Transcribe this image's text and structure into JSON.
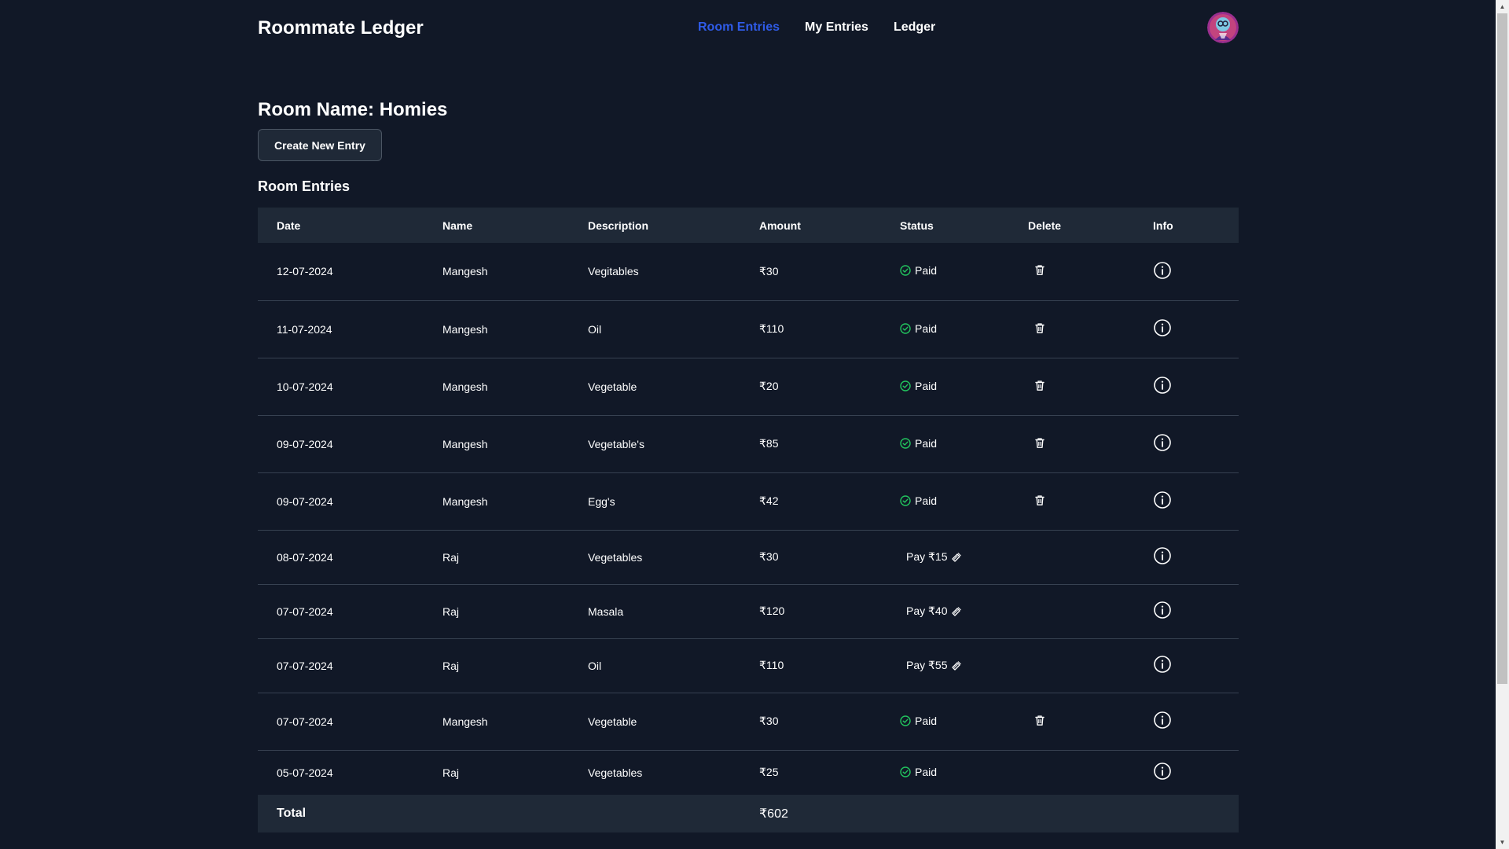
{
  "app": {
    "brand": "Roommate Ledger"
  },
  "nav": {
    "items": [
      {
        "label": "Room Entries",
        "active": true
      },
      {
        "label": "My Entries",
        "active": false
      },
      {
        "label": "Ledger",
        "active": false
      }
    ]
  },
  "room": {
    "title": "Room Name: Homies",
    "create_button": "Create New Entry",
    "section_title": "Room Entries"
  },
  "table": {
    "headers": {
      "date": "Date",
      "name": "Name",
      "description": "Description",
      "amount": "Amount",
      "status": "Status",
      "delete": "Delete",
      "info": "Info"
    },
    "rows": [
      {
        "date": "12-07-2024",
        "name": "Mangesh",
        "description": "Vegitables",
        "amount": "₹30",
        "status": "Paid"
      },
      {
        "date": "11-07-2024",
        "name": "Mangesh",
        "description": "Oil",
        "amount": "₹110",
        "status": "Paid"
      },
      {
        "date": "10-07-2024",
        "name": "Mangesh",
        "description": "Vegetable",
        "amount": "₹20",
        "status": "Paid"
      },
      {
        "date": "09-07-2024",
        "name": "Mangesh",
        "description": "Vegetable's",
        "amount": "₹85",
        "status": "Paid"
      },
      {
        "date": "09-07-2024",
        "name": "Mangesh",
        "description": "Egg's",
        "amount": "₹42",
        "status": "Paid"
      },
      {
        "date": "08-07-2024",
        "name": "Raj",
        "description": "Vegetables",
        "amount": "₹30",
        "status": "Pay ₹15"
      },
      {
        "date": "07-07-2024",
        "name": "Raj",
        "description": "Masala",
        "amount": "₹120",
        "status": "Pay ₹40"
      },
      {
        "date": "07-07-2024",
        "name": "Raj",
        "description": "Oil",
        "amount": "₹110",
        "status": "Pay ₹55"
      },
      {
        "date": "07-07-2024",
        "name": "Mangesh",
        "description": "Vegetable",
        "amount": "₹30",
        "status": "Paid"
      },
      {
        "date": "05-07-2024",
        "name": "Raj",
        "description": "Vegetables",
        "amount": "₹25",
        "status": "Paid"
      }
    ],
    "total_label": "Total",
    "total_amount": "₹602"
  },
  "colors": {
    "background": "#111827",
    "header_row": "#1f2937",
    "active_nav": "#2f5be7",
    "paid_icon": "#22c55e"
  },
  "icons": {
    "paid": "check-circle-icon",
    "pay": "money-send-icon",
    "delete": "trash-icon",
    "info": "info-circle-icon"
  }
}
